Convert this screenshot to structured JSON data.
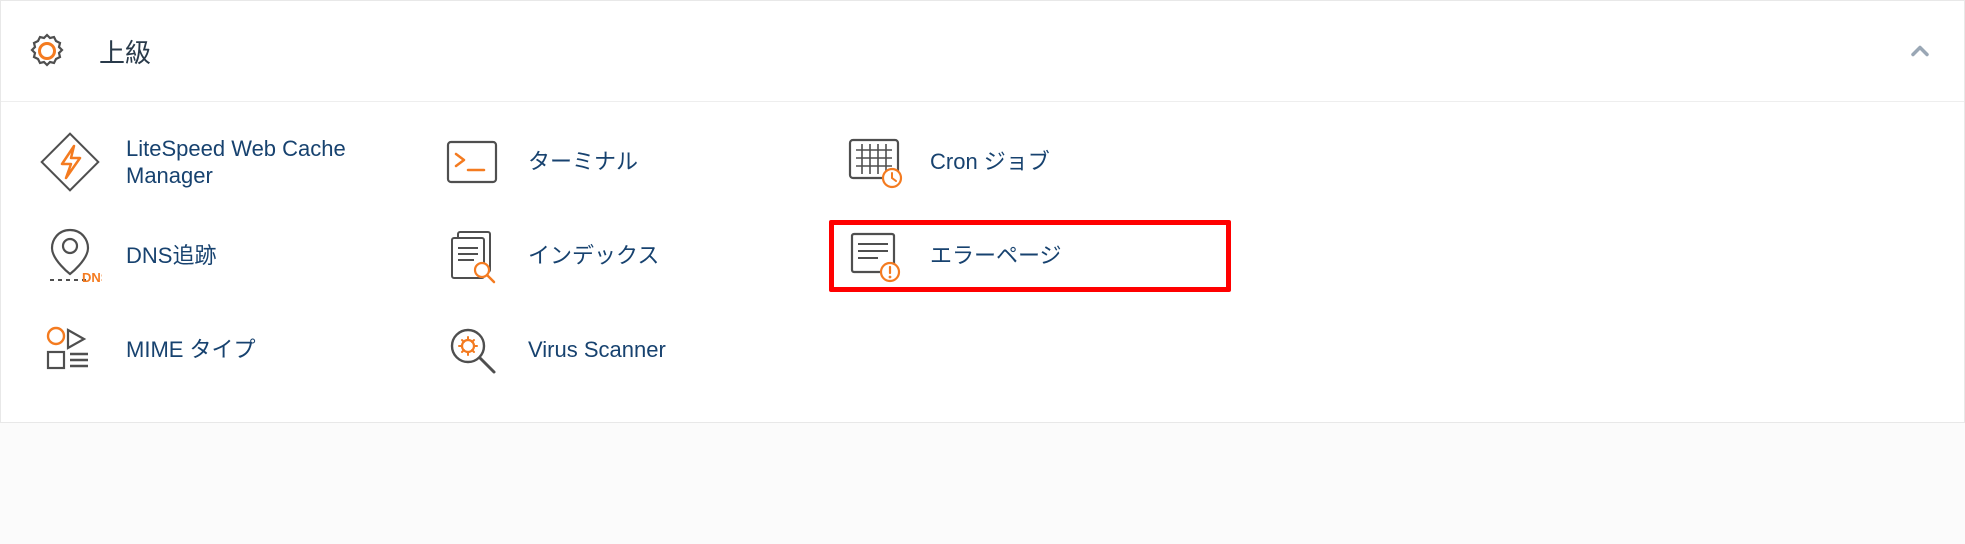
{
  "section": {
    "title": "上級"
  },
  "items": {
    "litespeed": {
      "label": "LiteSpeed Web Cache Manager"
    },
    "terminal": {
      "label": "ターミナル"
    },
    "cron": {
      "label": "Cron ジョブ"
    },
    "dns": {
      "label": "DNS追跡"
    },
    "indexes": {
      "label": "インデックス"
    },
    "errorpages": {
      "label": "エラーページ"
    },
    "mime": {
      "label": "MIME タイプ"
    },
    "virus": {
      "label": "Virus Scanner"
    }
  },
  "highlighted_item": "errorpages"
}
